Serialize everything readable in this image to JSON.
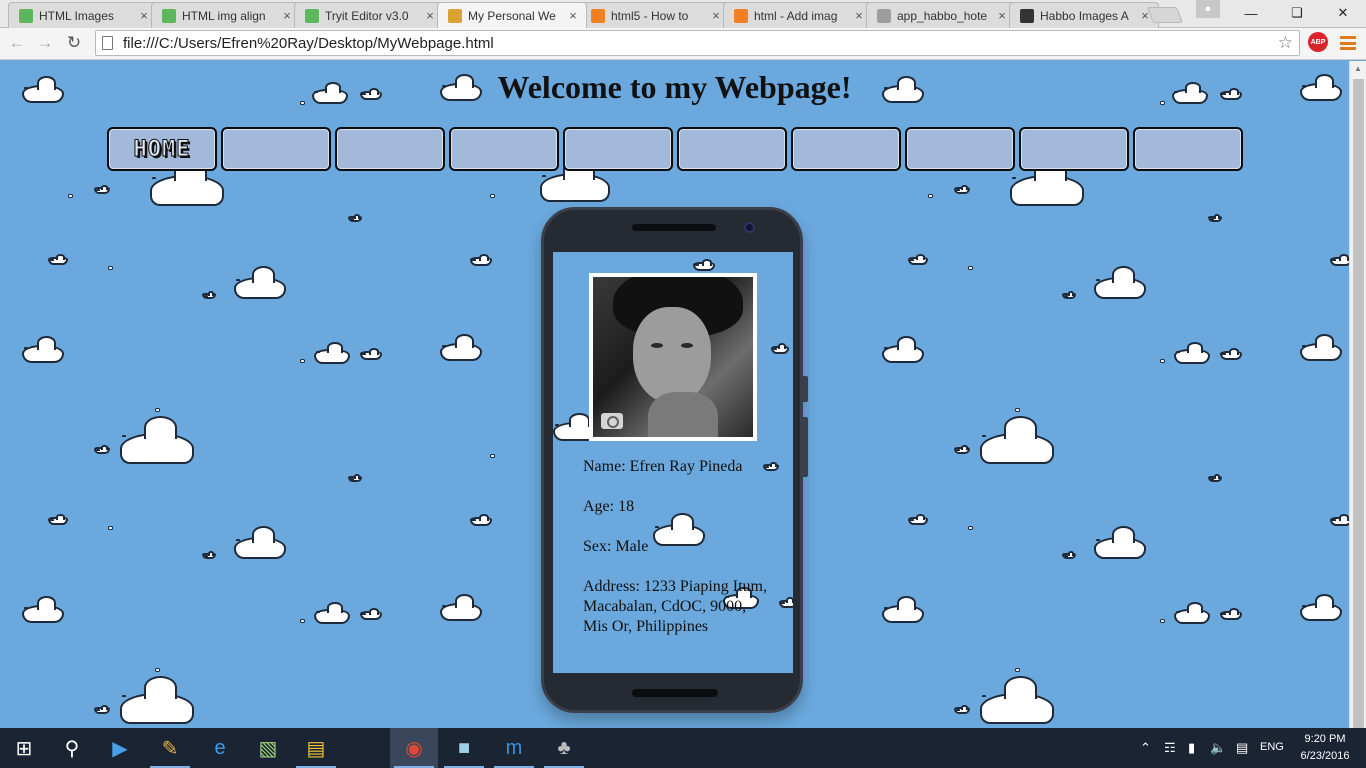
{
  "browser": {
    "tabs": [
      {
        "title": "HTML Images",
        "icon": "w3schools-icon",
        "icon_color": "#5cb85c"
      },
      {
        "title": "HTML img align",
        "icon": "w3schools-icon",
        "icon_color": "#5cb85c"
      },
      {
        "title": "Tryit Editor v3.0",
        "icon": "w3schools-icon",
        "icon_color": "#5cb85c"
      },
      {
        "title": "My Personal We",
        "icon": "page-favicon",
        "icon_color": "#d8a431",
        "active": true
      },
      {
        "title": "html5 - How to",
        "icon": "stackoverflow-icon",
        "icon_color": "#f48024"
      },
      {
        "title": "html - Add imag",
        "icon": "stackoverflow-icon",
        "icon_color": "#f48024"
      },
      {
        "title": "app_habbo_hote",
        "icon": "document-icon",
        "icon_color": "#9e9e9e"
      },
      {
        "title": "Habbo Images A",
        "icon": "habbo-icon",
        "icon_color": "#333333"
      }
    ],
    "url": "file:///C:/Users/Efren%20Ray/Desktop/MyWebpage.html"
  },
  "page": {
    "title": "Welcome to my Webpage!",
    "nav": {
      "home_label": "HOME",
      "empty_buttons": 9
    },
    "profile": {
      "name": "Name: Efren Ray Pineda",
      "age": "Age: 18",
      "sex": "Sex: Male",
      "address": "Address: 1233 Piaping Itum, Macabalan, CdOC,  9000, Mis Or, Philippines"
    }
  },
  "taskbar": {
    "apps": [
      "start-icon",
      "search-icon",
      "media-player-icon",
      "paint-icon",
      "edge-icon",
      "file-manager-icon",
      "file-explorer-icon",
      "chrome-icon",
      "notepad-icon",
      "maxthon-icon",
      "gimp-icon"
    ],
    "language": "ENG",
    "time": "9:20 PM",
    "date": "6/23/2016"
  }
}
